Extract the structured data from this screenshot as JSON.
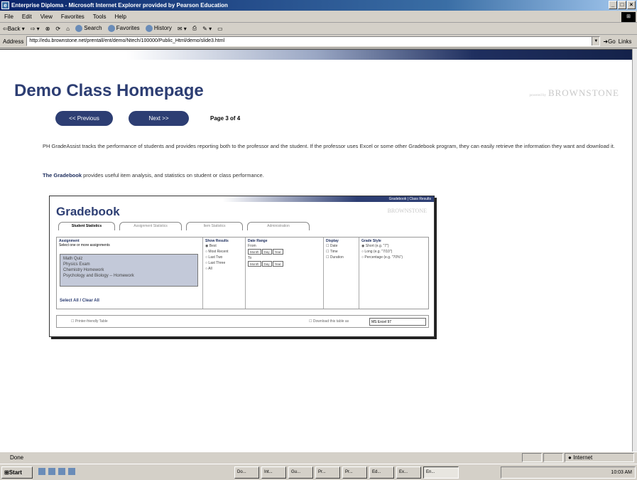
{
  "window": {
    "title": "Enterprise Diploma - Microsoft Internet Explorer provided by Pearson Education",
    "controls": [
      "_",
      "□",
      "×"
    ]
  },
  "menu": [
    "File",
    "Edit",
    "View",
    "Favorites",
    "Tools",
    "Help"
  ],
  "toolbar": {
    "back": "Back",
    "search": "Search",
    "favorites": "Favorites",
    "history": "History"
  },
  "address": {
    "label": "Address",
    "url": "http://edu.brownstone.net/prentall/ent/demo/Ntech/100000/Public_Html/demo/slide3.html",
    "go": "Go",
    "links": "Links"
  },
  "page": {
    "title": "Demo Class Homepage",
    "brand_prefix": "powered by",
    "brand": "BROWNSTONE",
    "prev": "<< Previous",
    "next": "Next >>",
    "page_indicator": "Page 3 of 4",
    "para1": "PH GradeAssist tracks the performance of students and provides reporting both to the professor and the student. If the professor uses Excel or some other Gradebook program, they can easily retrieve the information they want and download it.",
    "para2_bold": "The Gradebook",
    "para2_rest": " provides useful item analysis, and statistics on student or class performance."
  },
  "gradebook": {
    "links": "Gradebook | Class Results",
    "title": "Gradebook",
    "brand": "BROWNSTONE",
    "tabs": [
      "Student Statistics",
      "Assignment Statistics",
      "Item Statistics",
      "Administration"
    ],
    "assign_header": "Assignment",
    "assign_hint": "Select one or more assignments",
    "assignments": [
      "Math Quiz",
      "Physics Exam",
      "Chemistry Homework",
      "Psychology and Biology -- Homework"
    ],
    "select_all": "Select All / Clear All",
    "show_results_header": "Show Results",
    "show_results": [
      "Best",
      "Most Recent",
      "Last Two",
      "Last Three",
      "All"
    ],
    "date_header": "Date Range",
    "from": "From",
    "to": "To",
    "month": "Month",
    "day": "Day",
    "year": "Year",
    "display_header": "Display",
    "display": [
      "Date",
      "Time",
      "Duration"
    ],
    "grade_header": "Grade Style",
    "grades": [
      "Short (e.g. \"7\")",
      "Long (e.g. \"7/10\")",
      "Percentage (e.g. \"70%\")"
    ],
    "printer": "Printer-friendly Table",
    "download": "Download this table as",
    "download_format": "MS Excel 97"
  },
  "status": {
    "text": "Done",
    "zone": "Internet"
  },
  "taskbar": {
    "start": "Start",
    "tasks": [
      "Do...",
      "Int...",
      "Gu...",
      "Pr...",
      "Pr...",
      "Ed...",
      "Ex...",
      "En..."
    ],
    "clock": "10:03 AM"
  }
}
